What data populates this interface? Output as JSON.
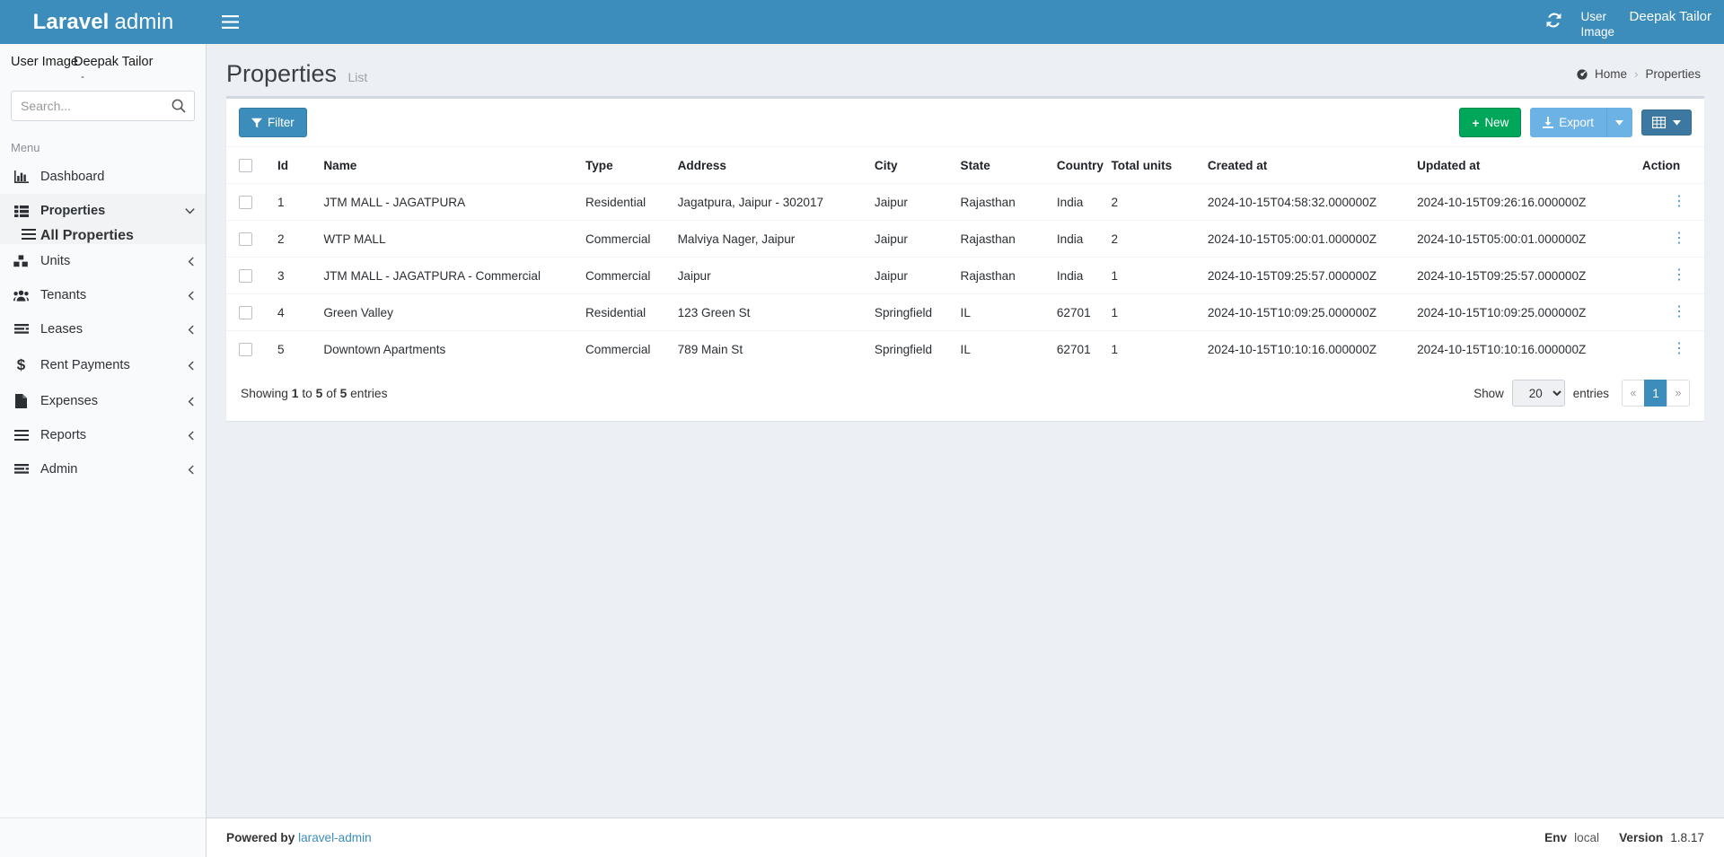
{
  "navbar": {
    "brand_bold": "Laravel",
    "brand_light": "admin",
    "toggle_icon": "hamburger-icon",
    "refresh_icon": "refresh-icon",
    "user_image_alt": "User Image",
    "user_name": "Deepak Tailor"
  },
  "sidebar": {
    "user_panel_alt": "User Image",
    "user_panel_name": "Deepak Tailor",
    "user_panel_status": "-",
    "search_placeholder": "Search...",
    "search_value": "",
    "search_icon": "search-icon",
    "menu_label": "Menu",
    "items": [
      {
        "label": "Dashboard",
        "icon": "bar-chart-icon",
        "caret": ""
      },
      {
        "label": "Properties",
        "icon": "th-list-icon",
        "caret": "⌄"
      },
      {
        "label": "All Properties",
        "icon": "bars-icon",
        "caret": ""
      },
      {
        "label": "Units",
        "icon": "cubes-icon",
        "caret": "‹"
      },
      {
        "label": "Tenants",
        "icon": "users-icon",
        "caret": "‹"
      },
      {
        "label": "Leases",
        "icon": "list-alt-icon",
        "caret": "‹"
      },
      {
        "label": "Rent Payments",
        "icon": "dollar-icon",
        "caret": "‹"
      },
      {
        "label": "Expenses",
        "icon": "file-icon",
        "caret": "‹"
      },
      {
        "label": "Reports",
        "icon": "bars-icon",
        "caret": "‹"
      },
      {
        "label": "Admin",
        "icon": "list-alt-icon",
        "caret": "‹"
      }
    ]
  },
  "page": {
    "title": "Properties",
    "subtitle": "List",
    "breadcrumb_home": "Home",
    "breadcrumb_sep": "›",
    "breadcrumb_current": "Properties",
    "home_icon": "dashboard-home-icon"
  },
  "toolbar": {
    "filter_label": "Filter",
    "filter_icon": "funnel-icon",
    "new_label": "New",
    "new_icon": "plus-icon",
    "export_label": "Export",
    "export_icon": "download-icon",
    "export_caret_icon": "caret-down-icon",
    "grid_icon": "table-icon",
    "grid_caret_icon": "caret-down-icon"
  },
  "table": {
    "columns": [
      "Id",
      "Name",
      "Type",
      "Address",
      "City",
      "State",
      "Country",
      "Total units",
      "Created at",
      "Updated at",
      "Action"
    ],
    "action_icon": "vertical-ellipsis-icon",
    "rows": [
      {
        "id": "1",
        "name": "JTM MALL - JAGATPURA",
        "type": "Residential",
        "address": "Jagatpura, Jaipur - 302017",
        "city": "Jaipur",
        "state": "Rajasthan",
        "country": "India",
        "total_units": "2",
        "created_at": "2024-10-15T04:58:32.000000Z",
        "updated_at": "2024-10-15T09:26:16.000000Z"
      },
      {
        "id": "2",
        "name": "WTP MALL",
        "type": "Commercial",
        "address": "Malviya Nager, Jaipur",
        "city": "Jaipur",
        "state": "Rajasthan",
        "country": "India",
        "total_units": "2",
        "created_at": "2024-10-15T05:00:01.000000Z",
        "updated_at": "2024-10-15T05:00:01.000000Z"
      },
      {
        "id": "3",
        "name": "JTM MALL - JAGATPURA - Commercial",
        "type": "Commercial",
        "address": "Jaipur",
        "city": "Jaipur",
        "state": "Rajasthan",
        "country": "India",
        "total_units": "1",
        "created_at": "2024-10-15T09:25:57.000000Z",
        "updated_at": "2024-10-15T09:25:57.000000Z"
      },
      {
        "id": "4",
        "name": "Green Valley",
        "type": "Residential",
        "address": "123 Green St",
        "city": "Springfield",
        "state": "IL",
        "country": "62701",
        "total_units": "1",
        "created_at": "2024-10-15T10:09:25.000000Z",
        "updated_at": "2024-10-15T10:09:25.000000Z"
      },
      {
        "id": "5",
        "name": "Downtown Apartments",
        "type": "Commercial",
        "address": "789 Main St",
        "city": "Springfield",
        "state": "IL",
        "country": "62701",
        "total_units": "1",
        "created_at": "2024-10-15T10:10:16.000000Z",
        "updated_at": "2024-10-15T10:10:16.000000Z"
      }
    ]
  },
  "footer_bar": {
    "showing_prefix": "Showing",
    "showing_from": "1",
    "showing_to_word": "to",
    "showing_to": "5",
    "showing_of_word": "of",
    "showing_total": "5",
    "showing_suffix": "entries",
    "show_label": "Show",
    "per_page": "20",
    "entries_label": "entries",
    "page_first": "«",
    "page_current": "1",
    "page_last": "»"
  },
  "footer": {
    "powered_by": "Powered by",
    "powered_link": "laravel-admin",
    "env_label": "Env",
    "env_value": "local",
    "version_label": "Version",
    "version_value": "1.8.17"
  },
  "colors": {
    "brand_blue": "#3c8dbc",
    "green": "#00a65a",
    "export_blue": "#6cb2e4",
    "grid_blue": "#3c78a0",
    "page_bg": "#ecf0f5"
  }
}
